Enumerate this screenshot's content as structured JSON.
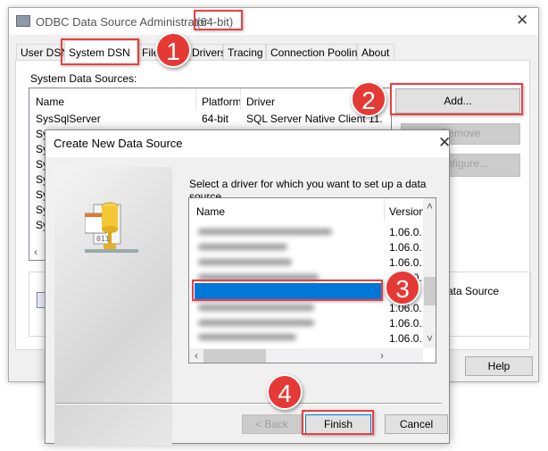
{
  "main_window": {
    "title": "ODBC Data Source Administrator",
    "title_suffix": "(64-bit)",
    "tabs": [
      {
        "label": "User DSN"
      },
      {
        "label": "System DSN"
      },
      {
        "label": "File DSN"
      },
      {
        "label": "Drivers"
      },
      {
        "label": "Tracing"
      },
      {
        "label": "Connection Pooling"
      },
      {
        "label": "About"
      }
    ],
    "section_label": "System Data Sources:",
    "columns": [
      "Name",
      "Platform",
      "Driver"
    ],
    "rows": [
      {
        "name": "SysSqlServer",
        "platform": "64-bit",
        "driver": "SQL Server Native Client 11."
      },
      {
        "name": "Sy"
      },
      {
        "name": "Sy"
      },
      {
        "name": "Sy"
      },
      {
        "name": "Sy"
      },
      {
        "name": "Sy"
      },
      {
        "name": "Sy"
      },
      {
        "name": "Sy"
      }
    ],
    "buttons": {
      "add": "Add...",
      "remove": "Remove",
      "configure": "Configure...",
      "help": "Help"
    },
    "info_text": "ata Source"
  },
  "dialog": {
    "title": "Create New Data Source",
    "instruction": "Select a driver for which you want to set up a data source.",
    "columns": [
      "Name",
      "Version"
    ],
    "versions": [
      "1.06.0...",
      "1.06.0...",
      "1.06.0...",
      "1.06.0...",
      "",
      "1.06.0...",
      "1.06.0...",
      "1.06.0..."
    ],
    "buttons": {
      "back": "< Back",
      "finish": "Finish",
      "cancel": "Cancel"
    }
  },
  "callouts": [
    "1",
    "2",
    "3",
    "4"
  ],
  "colors": {
    "callout": "#e53935",
    "selection": "#0078d7"
  }
}
